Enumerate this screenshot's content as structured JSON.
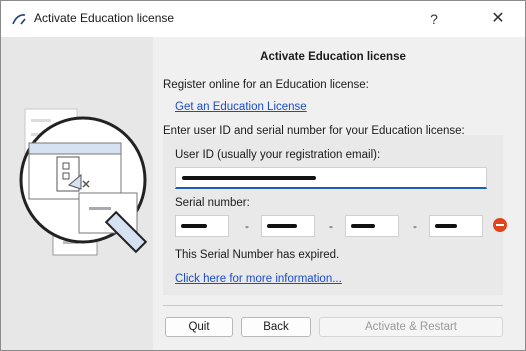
{
  "window": {
    "title": "Activate Education license",
    "help_glyph": "?",
    "close_glyph": "✕"
  },
  "dialog": {
    "heading": "Activate Education license",
    "register_text": "Register online for an Education license:",
    "get_license_link": "Get an Education License",
    "enter_text": "Enter user ID and serial number for your Education license:",
    "user_id_label": "User ID (usually your registration email):",
    "serial_label": "Serial number:",
    "serial_separator": "-",
    "expired_text": "This Serial Number has expired.",
    "more_info_link": "Click here for more information..."
  },
  "buttons": {
    "quit": "Quit",
    "back": "Back",
    "activate": "Activate & Restart"
  },
  "colors": {
    "accent": "#1a5fb4",
    "link": "#1a4bcf",
    "error": "#e0441c",
    "illustration_stroke": "#333333",
    "illustration_fill": "#d6e1f2"
  },
  "icons": {
    "app": "arc-logo-icon",
    "error": "minus-circle-icon",
    "illustration": "magnifier-document-icon"
  }
}
